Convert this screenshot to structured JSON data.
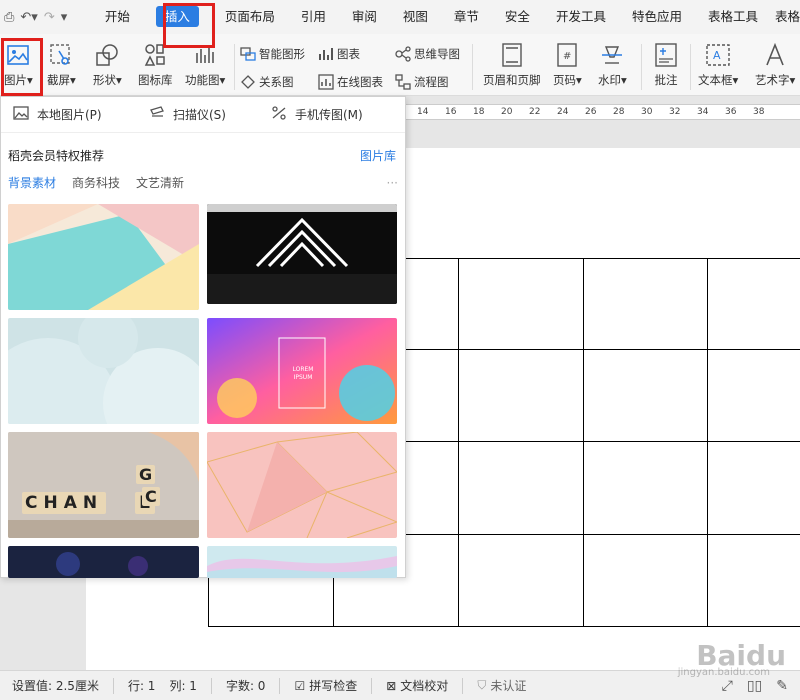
{
  "menubar": {
    "items": [
      "开始",
      "插入",
      "页面布局",
      "引用",
      "审阅",
      "视图",
      "章节",
      "安全",
      "开发工具",
      "特色应用",
      "表格工具",
      "表格"
    ]
  },
  "ribbon": {
    "picture": "图片",
    "screenshot": "截屏",
    "shape": "形状",
    "icon_lib": "图标库",
    "func_chart": "功能图",
    "smart_shape": "智能图形",
    "chart": "图表",
    "mindmap": "思维导图",
    "relation": "关系图",
    "online_chart": "在线图表",
    "flowchart": "流程图",
    "header_footer": "页眉和页脚",
    "page_number": "页码",
    "watermark": "水印",
    "comment": "批注",
    "textbox": "文本框",
    "wordart": "艺术字"
  },
  "ruler": {
    "ticks": [
      "14",
      "16",
      "18",
      "20",
      "22",
      "24",
      "26",
      "28",
      "30",
      "32",
      "34",
      "36",
      "38"
    ]
  },
  "dropdown": {
    "sources": [
      "本地图片(P)",
      "扫描仪(S)",
      "手机传图(M)"
    ],
    "rec_title": "稻壳会员特权推荐",
    "rec_link": "图片库",
    "categories": [
      "背景素材",
      "商务科技",
      "文艺清新"
    ],
    "more": "···",
    "thumb_texts": {
      "lorem": "LOREM IPSUM",
      "change": "CHAN",
      "change_e": "E",
      "change_g": "G",
      "change_c": "C"
    }
  },
  "statusbar": {
    "setting": "设置值: 2.5厘米",
    "row": "行: 1",
    "col": "列: 1",
    "words": "字数: 0",
    "spell": "拼写检查",
    "proof": "文档校对",
    "cert": "未认证"
  },
  "watermark": {
    "main": "Baidu",
    "sub": "jingyan.baidu.com"
  },
  "colors": {
    "accent": "#2b7de2",
    "highlight": "#e0201c"
  }
}
